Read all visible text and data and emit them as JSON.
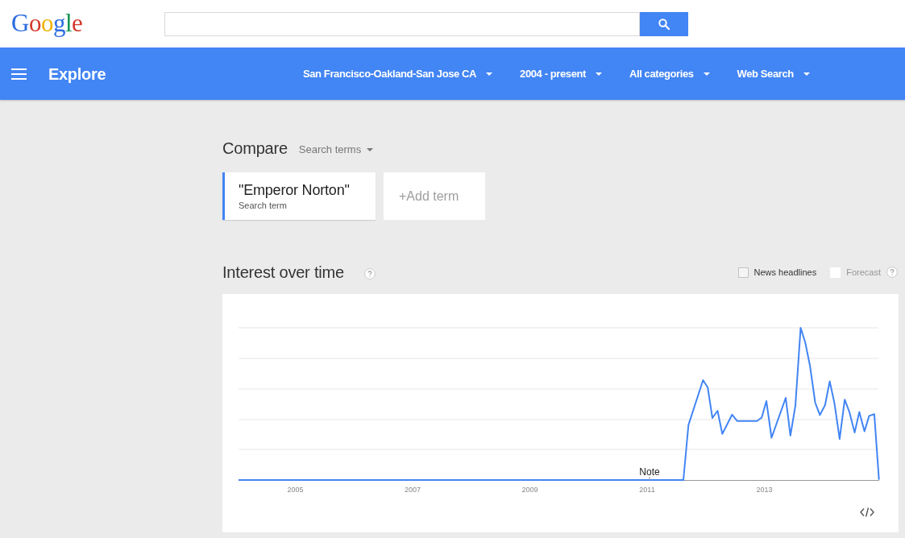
{
  "header": {
    "logo": "Google"
  },
  "toolbar": {
    "title": "Explore",
    "filters": [
      "San Francisco-Oakland-San Jose CA",
      "2004 - present",
      "All categories",
      "Web Search"
    ]
  },
  "compare": {
    "title": "Compare",
    "mode": "Search terms",
    "terms": [
      {
        "term": "\"Emperor Norton\"",
        "caption": "Search term"
      }
    ],
    "add_term": "+Add term"
  },
  "interest": {
    "title": "Interest over time",
    "options": [
      {
        "label": "News headlines",
        "checked": false,
        "disabled": false
      },
      {
        "label": "Forecast",
        "checked": false,
        "disabled": true
      }
    ],
    "chart": {
      "year_labels": [
        "2005",
        "2007",
        "2009",
        "2011",
        "2013"
      ],
      "annotation": "Note"
    }
  }
}
